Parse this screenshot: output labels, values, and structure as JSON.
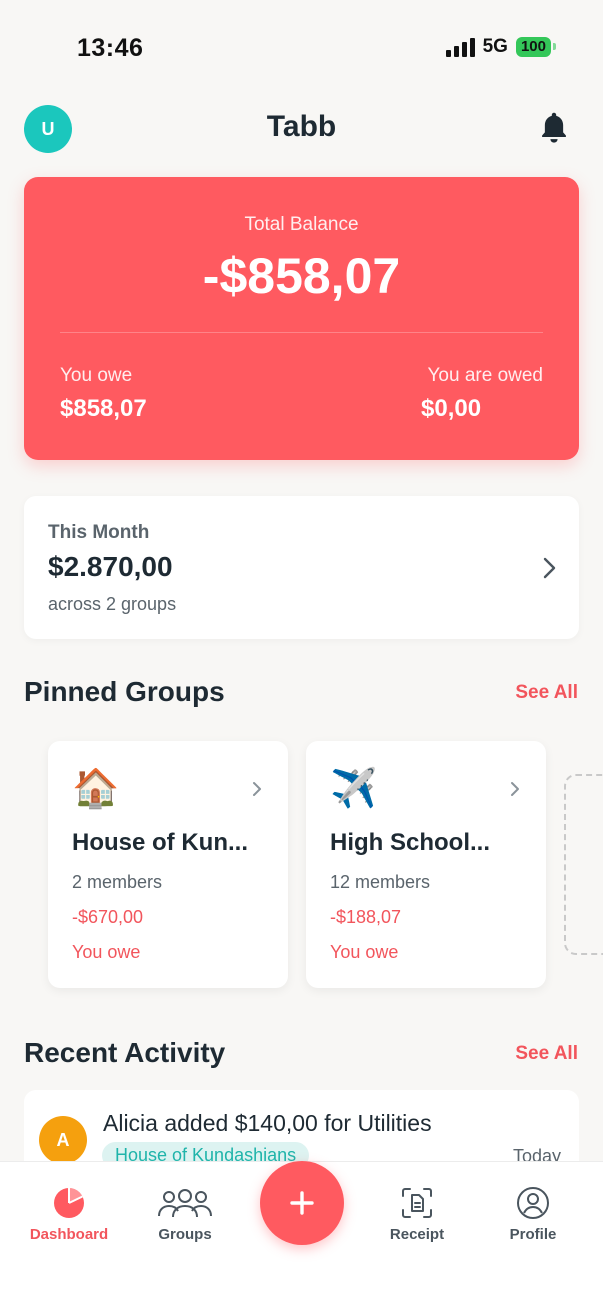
{
  "status_bar": {
    "time": "13:46",
    "network": "5G",
    "battery": "100"
  },
  "header": {
    "avatar_initial": "U",
    "title": "Tabb"
  },
  "balance": {
    "label": "Total Balance",
    "amount": "-$858,07",
    "owe_label": "You owe",
    "owe_value": "$858,07",
    "owed_label": "You are owed",
    "owed_value": "$0,00"
  },
  "month": {
    "label": "This Month",
    "amount": "$2.870,00",
    "subtitle": "across 2 groups"
  },
  "pinned": {
    "title": "Pinned Groups",
    "see_all": "See All",
    "groups": [
      {
        "emoji": "🏠",
        "name": "House of Kun...",
        "members": "2 members",
        "amount": "-$670,00",
        "status": "You owe"
      },
      {
        "emoji": "✈️",
        "name": "High School...",
        "members": "12 members",
        "amount": "-$188,07",
        "status": "You owe"
      }
    ]
  },
  "activity": {
    "title": "Recent Activity",
    "see_all": "See All",
    "items": [
      {
        "initial": "A",
        "text": "Alicia added $140,00 for Utilities",
        "group": "House of Kundashians",
        "time": "Today"
      }
    ]
  },
  "tabs": [
    {
      "label": "Dashboard",
      "icon": "pie-chart-icon"
    },
    {
      "label": "Groups",
      "icon": "people-icon"
    },
    {
      "label": "Receipt",
      "icon": "receipt-scan-icon"
    },
    {
      "label": "Profile",
      "icon": "profile-icon"
    }
  ],
  "colors": {
    "accent": "#FF5A60",
    "teal": "#1BC7BD",
    "orange": "#F5A00E"
  }
}
